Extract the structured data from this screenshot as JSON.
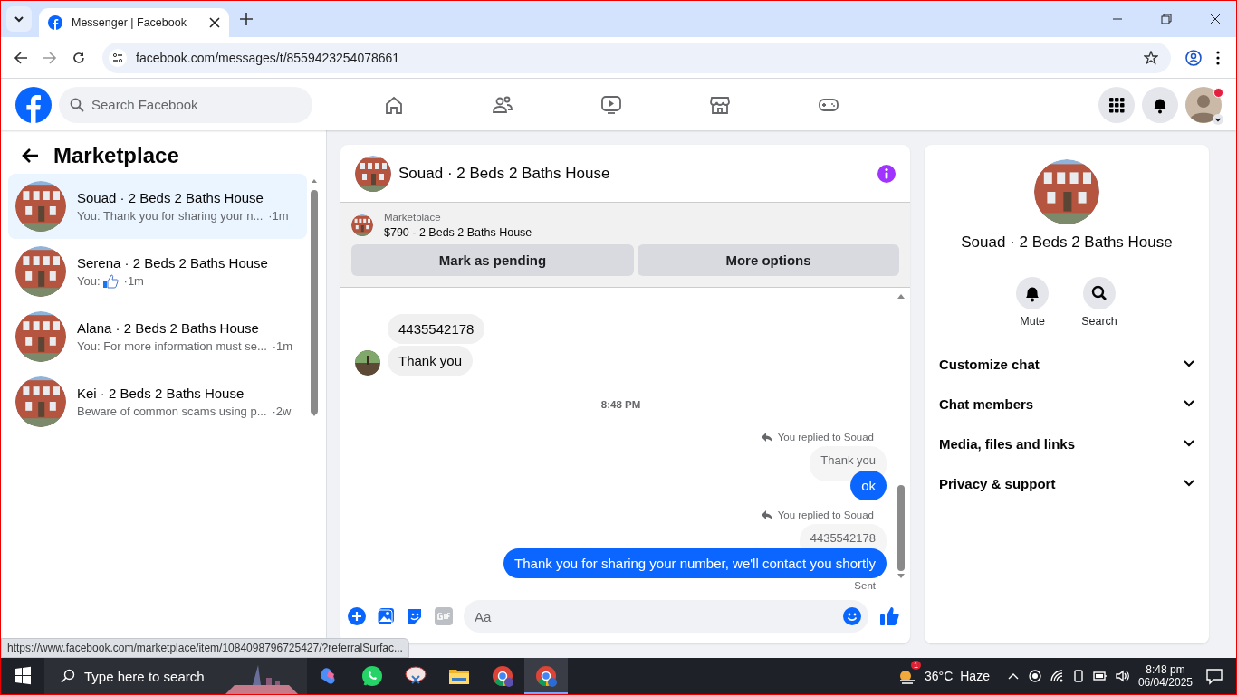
{
  "browser": {
    "tab": {
      "title": "Messenger | Facebook",
      "selected": true
    },
    "url": "facebook.com/messages/t/8559423254078661"
  },
  "header": {
    "search_placeholder": "Search Facebook",
    "notification_dot": true
  },
  "sidebar": {
    "title": "Marketplace",
    "conversations": [
      {
        "name": "Souad · 2 Beds 2 Baths House",
        "kind": "text",
        "preview": "You: Thank you for sharing your n...",
        "time": "·1m",
        "selected": true
      },
      {
        "name": "Serena · 2 Beds 2 Baths House",
        "kind": "like",
        "preview": "You:",
        "time": "·1m",
        "selected": false
      },
      {
        "name": "Alana · 2 Beds 2 Baths House",
        "kind": "text",
        "preview": "You: For more information must se...",
        "time": "·1m",
        "selected": false
      },
      {
        "name": "Kei · 2 Beds 2 Baths House",
        "kind": "text",
        "preview": "Beware of common scams using p...",
        "time": "·2w",
        "selected": false
      }
    ]
  },
  "chat": {
    "title": "Souad · 2 Beds 2 Baths House",
    "listing": {
      "label": "Marketplace",
      "title": "$790 - 2 Beds 2 Baths House"
    },
    "buttons": [
      "Mark as pending",
      "More options"
    ],
    "messages": [
      {
        "kind": "incoming",
        "text": "4435542178",
        "avatar": false
      },
      {
        "kind": "incoming",
        "text": "Thank you",
        "avatar": true
      },
      {
        "kind": "time",
        "text": "8:48 PM"
      },
      {
        "kind": "reply",
        "text": "You replied to Souad"
      },
      {
        "kind": "quote",
        "text": "Thank you"
      },
      {
        "kind": "outgoing",
        "text": "ok"
      },
      {
        "kind": "reply",
        "text": "You replied to Souad"
      },
      {
        "kind": "quote",
        "text": "4435542178"
      },
      {
        "kind": "outgoing",
        "text": "Thank you for sharing your number, we'll contact you shortly"
      },
      {
        "kind": "status",
        "text": "Sent"
      }
    ],
    "composer_placeholder": "Aa"
  },
  "details": {
    "name": "Souad · 2 Beds 2 Baths House",
    "actions": [
      {
        "kind": "bell",
        "label": "Mute"
      },
      {
        "kind": "search",
        "label": "Search"
      }
    ],
    "sections": [
      {
        "label": "Customize chat",
        "expanded": false
      },
      {
        "label": "Chat members",
        "expanded": false
      },
      {
        "label": "Media, files and links",
        "expanded": false
      },
      {
        "label": "Privacy & support",
        "expanded": false
      }
    ]
  },
  "status_url": "https://www.facebook.com/marketplace/item/1084098796725427/?referralSurfac...",
  "taskbar": {
    "search_placeholder": "Type here to search",
    "weather_badge": "1",
    "temperature": "36°C",
    "condition": "Haze",
    "time": "8:48 pm",
    "date": "06/04/2025"
  }
}
